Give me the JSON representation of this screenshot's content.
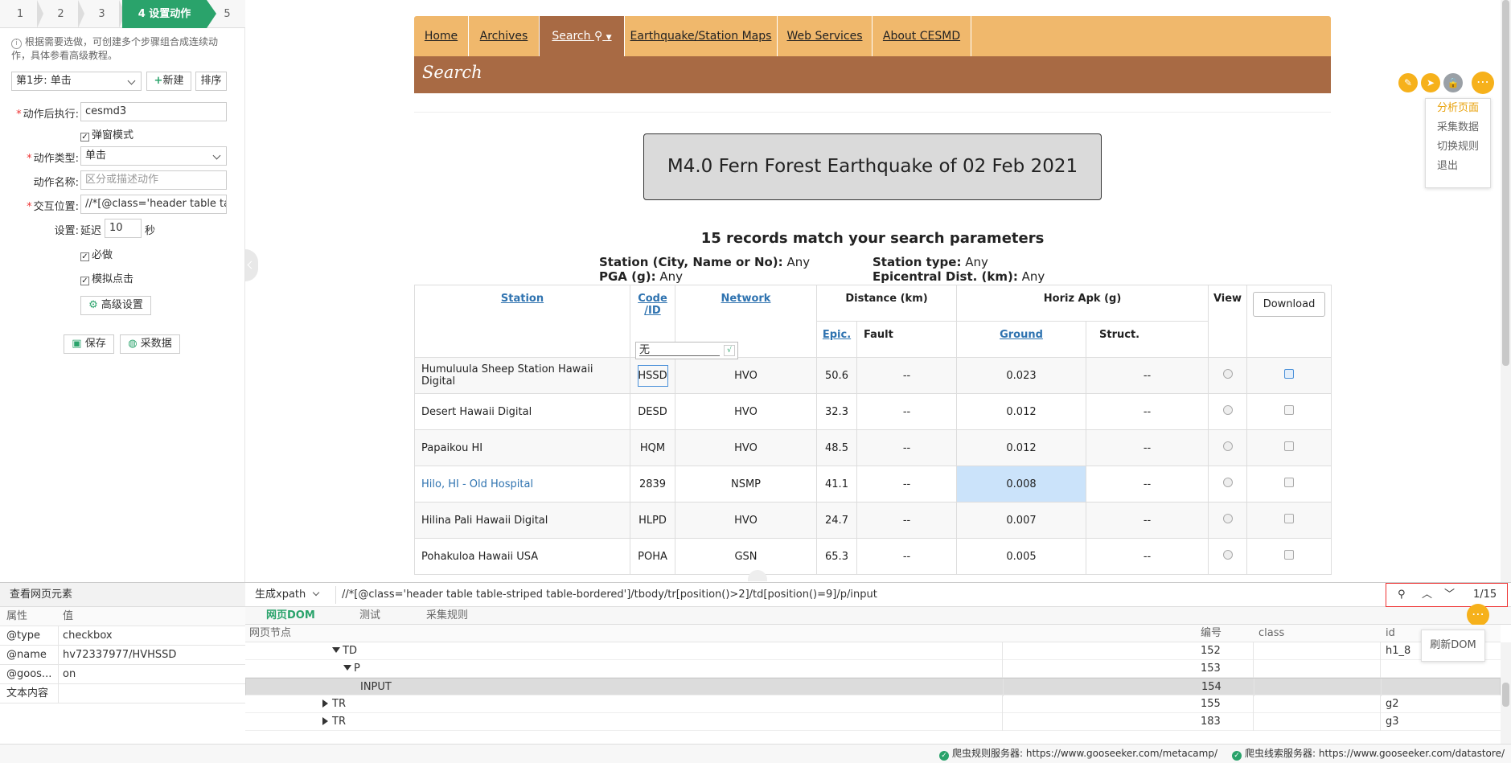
{
  "left": {
    "steps": [
      "1",
      "2",
      "3",
      "4 设置动作",
      "5"
    ],
    "tip": "根据需要选做，可创建多个步骤组合成连续动作，具体参看高级教程。",
    "step_select": "第1步: 单击",
    "new_label": "新建",
    "sort_label": "排序",
    "after_action_label": "动作后执行:",
    "after_action_value": "cesmd3",
    "popup_mode_label": "弹窗模式",
    "action_type_label": "动作类型:",
    "action_type_value": "单击",
    "action_name_label": "动作名称:",
    "action_name_placeholder": "区分或描述动作",
    "interact_label": "交互位置:",
    "interact_value": "//*[@class='header table tab",
    "settings_label": "设置:",
    "delay_label": "延迟",
    "delay_value": "10",
    "delay_unit": "秒",
    "required_label": "必做",
    "simulate_label": "模拟点击",
    "advanced_label": "高级设置",
    "save_label": "保存",
    "collect_label": "采数据"
  },
  "page": {
    "nav": [
      "Home",
      "Archives",
      "Search",
      "Earthquake/Station Maps",
      "Web Services",
      "About CESMD"
    ],
    "section_title": "Search",
    "earthquake_title": "M4.0 Fern Forest Earthquake of 02 Feb 2021",
    "records_text": "15 records match your search parameters",
    "params": {
      "station_label": "Station (City, Name or No):",
      "station_value": "Any",
      "type_label": "Station type:",
      "type_value": "Any",
      "pga_label": "PGA (g):",
      "pga_value": "Any",
      "epi_label": "Epicentral Dist. (km):",
      "epi_value": "Any"
    },
    "table_headers": {
      "station": "Station",
      "code_line1": "Code",
      "code_line2": "/ID",
      "network": "Network",
      "distance": "Distance (km)",
      "horiz": "Horiz  Apk (g)",
      "view": "View",
      "download": "Download",
      "epic": "Epic.",
      "fault": "Fault",
      "ground": "Ground",
      "struct": "Struct."
    },
    "popup_input_value": "无",
    "popup_ok": "√",
    "rows": [
      {
        "station": "Humuluula Sheep Station Hawaii Digital",
        "code": "HSSD",
        "network": "HVO",
        "epic": "50.6",
        "fault": "--",
        "ground": "0.023",
        "struct": "--"
      },
      {
        "station": "Desert Hawaii Digital",
        "code": "DESD",
        "network": "HVO",
        "epic": "32.3",
        "fault": "--",
        "ground": "0.012",
        "struct": "--"
      },
      {
        "station": "Papaikou HI",
        "code": "HQM",
        "network": "HVO",
        "epic": "48.5",
        "fault": "--",
        "ground": "0.012",
        "struct": "--"
      },
      {
        "station": "Hilo, HI - Old Hospital",
        "code": "2839",
        "network": "NSMP",
        "epic": "41.1",
        "fault": "--",
        "ground": "0.008",
        "struct": "--"
      },
      {
        "station": "Hilina Pali Hawaii Digital",
        "code": "HLPD",
        "network": "HVO",
        "epic": "24.7",
        "fault": "--",
        "ground": "0.007",
        "struct": "--"
      },
      {
        "station": "Pohakuloa Hawaii USA",
        "code": "POHA",
        "network": "GSN",
        "epic": "65.3",
        "fault": "--",
        "ground": "0.005",
        "struct": "--"
      }
    ]
  },
  "float_menu": [
    "分析页面",
    "采集数据",
    "切换规则",
    "退出"
  ],
  "bottom": {
    "inspect_title": "查看网页元素",
    "attr_header_key": "属性",
    "attr_header_value": "值",
    "attrs": [
      {
        "k": "@type",
        "v": "checkbox"
      },
      {
        "k": "@name",
        "v": "hv72337977/HVHSSD"
      },
      {
        "k": "@goos...",
        "v": "on"
      },
      {
        "k": "文本内容",
        "v": ""
      }
    ],
    "gen_xpath": "生成xpath",
    "xpath": "//*[@class='header table table-striped table-bordered']/tbody/tr[position()>2]/td[position()=9]/p/input",
    "match_count": "1/15",
    "tabs": [
      "网页DOM",
      "测试",
      "采集规则"
    ],
    "dom_headers": {
      "node": "网页节点",
      "num": "编号",
      "class": "class",
      "id": "id"
    },
    "dom_rows": [
      {
        "tag": "TD",
        "num": "152",
        "cls": "",
        "id": "h1_8"
      },
      {
        "tag": "P",
        "num": "153",
        "cls": "",
        "id": ""
      },
      {
        "tag": "INPUT",
        "num": "154",
        "cls": "",
        "id": ""
      },
      {
        "tag": "TR",
        "num": "155",
        "cls": "",
        "id": "g2"
      },
      {
        "tag": "TR",
        "num": "183",
        "cls": "",
        "id": "g3"
      }
    ],
    "refresh_dom": "刷新DOM",
    "status1": "爬虫规则服务器: https://www.gooseeker.com/metacamp/",
    "status2": "爬虫线索服务器: https://www.gooseeker.com/datastore/"
  },
  "colors": {
    "accent": "#f0b86c",
    "section": "#a86a44",
    "green": "#2aa36b",
    "orange": "#f6b11b"
  }
}
